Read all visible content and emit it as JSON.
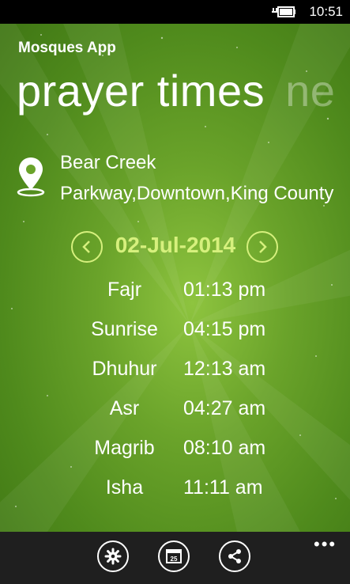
{
  "status_bar": {
    "time": "10:51",
    "battery_icon": "battery-charging-icon"
  },
  "app": {
    "title": "Mosques App"
  },
  "pivot": {
    "current": "prayer times",
    "next": "ne"
  },
  "location": {
    "icon": "location-pin-icon",
    "address": "Bear Creek Parkway,Downtown,King County"
  },
  "date": {
    "label": "02-Jul-2014",
    "prev_icon": "chevron-left-icon",
    "next_icon": "chevron-right-icon"
  },
  "prayers": [
    {
      "name": "Fajr",
      "time": "01:13 pm"
    },
    {
      "name": "Sunrise",
      "time": "04:15 pm"
    },
    {
      "name": "Dhuhur",
      "time": "12:13 am"
    },
    {
      "name": "Asr",
      "time": "04:27 am"
    },
    {
      "name": "Magrib",
      "time": "08:10 am"
    },
    {
      "name": "Isha",
      "time": "11:11 am"
    }
  ],
  "app_bar": {
    "buttons": [
      {
        "icon": "settings-icon"
      },
      {
        "icon": "calendar-icon",
        "text": "25"
      },
      {
        "icon": "share-icon"
      }
    ],
    "more": "•••"
  },
  "colors": {
    "accent": "#d6f07d",
    "background_green": "#6aa32a",
    "app_bar": "#1f1f1f"
  }
}
